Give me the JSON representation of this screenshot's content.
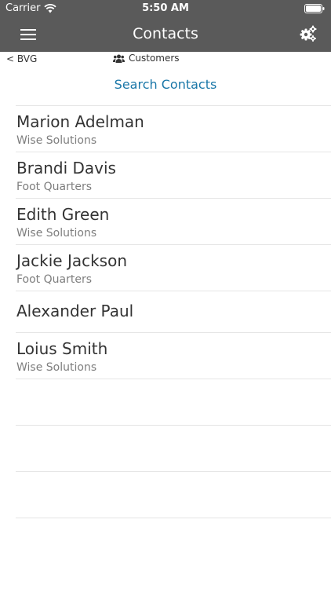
{
  "status_bar": {
    "carrier": "Carrier",
    "time": "5:50 AM"
  },
  "nav": {
    "title": "Contacts",
    "menu_icon": "hamburger-icon",
    "settings_icon": "gears-icon"
  },
  "subbar": {
    "back": "< BVG",
    "crumb": "Customers"
  },
  "search": {
    "label": "Search Contacts"
  },
  "contacts": [
    {
      "name": "Marion Adelman",
      "company": "Wise Solutions"
    },
    {
      "name": "Brandi Davis",
      "company": "Foot Quarters"
    },
    {
      "name": "Edith Green",
      "company": "Wise Solutions"
    },
    {
      "name": "Jackie Jackson",
      "company": "Foot Quarters"
    },
    {
      "name": "Alexander Paul",
      "company": ""
    },
    {
      "name": "Loius Smith",
      "company": "Wise Solutions"
    }
  ],
  "colors": {
    "navbar": "#5a5a5a",
    "accent": "#1a77a8",
    "divider": "#e5e5e5"
  }
}
